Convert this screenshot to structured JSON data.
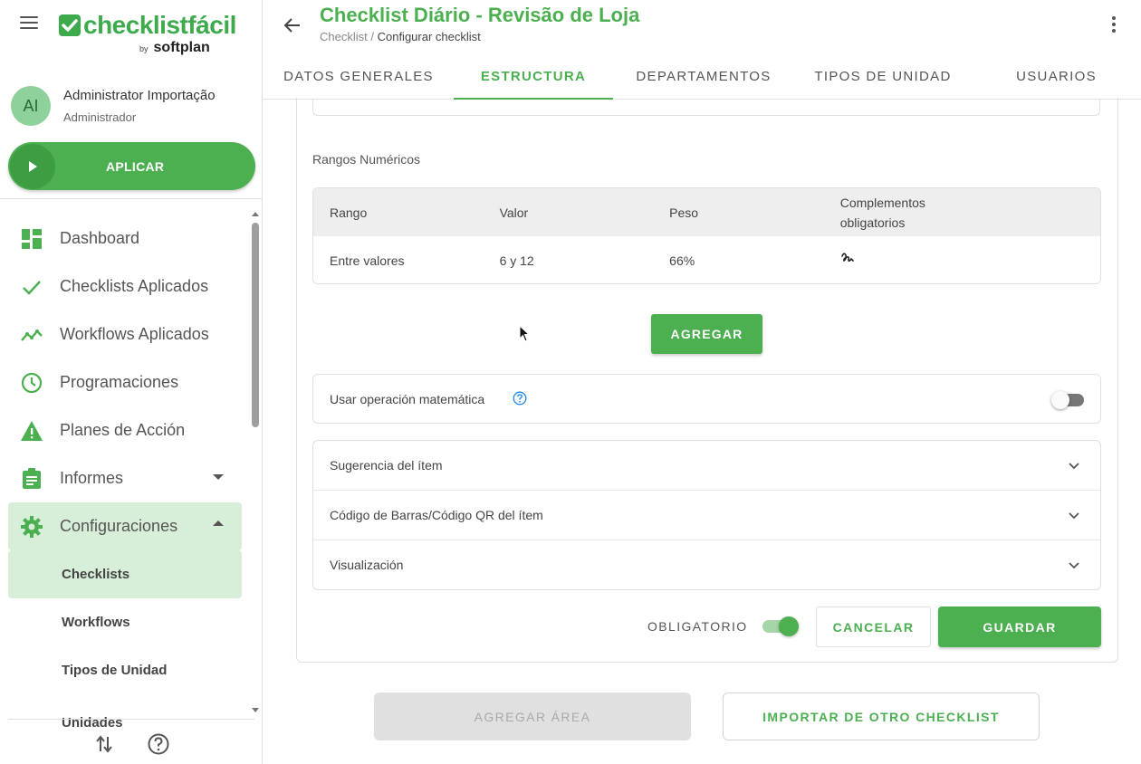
{
  "sidebar": {
    "logo": {
      "brand": "checklistfácil",
      "by": "by",
      "company": "softplan"
    },
    "user": {
      "initials": "AI",
      "name": "Administrator Importação",
      "role": "Administrador"
    },
    "apply_label": "APLICAR",
    "nav": [
      {
        "label": "Dashboard",
        "icon": "dashboard-icon"
      },
      {
        "label": "Checklists Aplicados",
        "icon": "check-icon"
      },
      {
        "label": "Workflows Aplicados",
        "icon": "trending-icon"
      },
      {
        "label": "Programaciones",
        "icon": "clock-icon"
      },
      {
        "label": "Planes de Acción",
        "icon": "warning-icon"
      },
      {
        "label": "Informes",
        "icon": "clipboard-icon"
      },
      {
        "label": "Configuraciones",
        "icon": "gear-icon"
      }
    ],
    "sub_nav": [
      {
        "label": "Checklists"
      },
      {
        "label": "Workflows"
      },
      {
        "label": "Tipos de Unidad"
      },
      {
        "label": "Unidades"
      }
    ]
  },
  "header": {
    "title": "Checklist Diário - Revisão de Loja",
    "breadcrumb_root": "Checklist",
    "breadcrumb_sep": " / ",
    "breadcrumb_current": "Configurar checklist",
    "tabs": [
      {
        "label": "DATOS GENERALES"
      },
      {
        "label": "ESTRUCTURA"
      },
      {
        "label": "DEPARTAMENTOS"
      },
      {
        "label": "TIPOS DE UNIDAD"
      },
      {
        "label": "USUARIOS"
      }
    ]
  },
  "ranges": {
    "section_label": "Rangos Numéricos",
    "columns": [
      "Rango",
      "Valor",
      "Peso",
      "Complementos obligatorios"
    ],
    "rows": [
      {
        "rango": "Entre valores",
        "valor": "6 y 12",
        "peso": "66%",
        "complemento_icon": "signature-icon"
      }
    ],
    "add_label": "AGREGAR"
  },
  "math": {
    "label": "Usar operación matemática",
    "enabled": false
  },
  "accordion": [
    {
      "label": "Sugerencia del ítem"
    },
    {
      "label": "Código de Barras/Código QR del ítem"
    },
    {
      "label": "Visualización"
    }
  ],
  "footer_actions": {
    "mandatory_label": "OBLIGATORIO",
    "mandatory": true,
    "cancel_label": "CANCELAR",
    "save_label": "GUARDAR"
  },
  "bottom_actions": {
    "add_area_label": "AGREGAR ÁREA",
    "import_label": "IMPORTAR DE OTRO CHECKLIST"
  },
  "colors": {
    "accent": "#4caf50",
    "accent_light": "#d7eed9",
    "header_bg": "#eeeeee"
  }
}
